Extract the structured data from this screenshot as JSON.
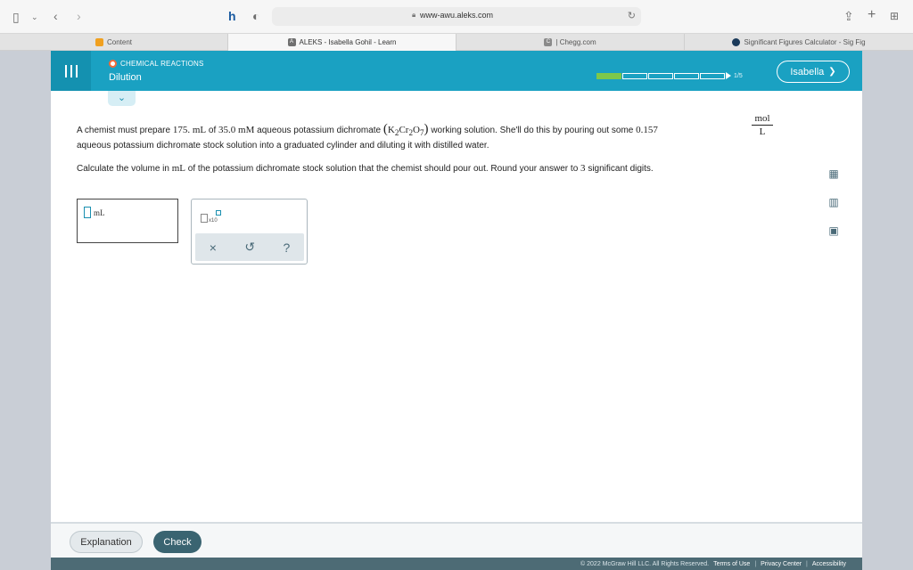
{
  "browser": {
    "url": "www-awu.aleks.com",
    "tabs": [
      {
        "label": "Content",
        "favicon_color": "#f0a020"
      },
      {
        "label": "ALEKS - Isabella Gohil - Learn",
        "favicon_color": "#707070"
      },
      {
        "label": "| Chegg.com",
        "favicon_color": "#8a8a8a"
      },
      {
        "label": "Significant Figures Calculator - Sig Fig",
        "favicon_color": "#1b3a5a"
      }
    ]
  },
  "header": {
    "topic_category": "CHEMICAL REACTIONS",
    "topic_title": "Dilution",
    "progress": {
      "completed": 1,
      "total": 5,
      "label": "1/5"
    },
    "user_name": "Isabella"
  },
  "question": {
    "line1_a": "A chemist must prepare",
    "line1_vol": "175. mL",
    "line1_b": "of",
    "line1_conc": "35.0 mM",
    "line1_c": "aqueous potassium dichromate",
    "line1_d": "working solution. She'll do this by pouring out some",
    "line1_stock": "0.157",
    "frac_num": "mol",
    "frac_den": "L",
    "line2": "aqueous potassium dichromate stock solution into a graduated cylinder and diluting it with distilled water.",
    "line3_a": "Calculate the volume in",
    "line3_unit": "mL",
    "line3_b": "of the potassium dichromate stock solution that the chemist should pour out. Round your answer to",
    "line3_digits": "3",
    "line3_c": "significant digits."
  },
  "answer": {
    "unit": "mL",
    "value": ""
  },
  "palette": {
    "sci_label": "x10",
    "clear": "×",
    "undo": "↺",
    "help": "?"
  },
  "bottom": {
    "explanation_label": "Explanation",
    "check_label": "Check"
  },
  "footer": {
    "copyright": "© 2022 McGraw Hill LLC. All Rights Reserved.",
    "terms": "Terms of Use",
    "privacy": "Privacy Center",
    "accessibility": "Accessibility"
  },
  "colors": {
    "accent": "#1aa1c2",
    "progress_done": "#7ec84a",
    "check_button": "#3a6471"
  }
}
